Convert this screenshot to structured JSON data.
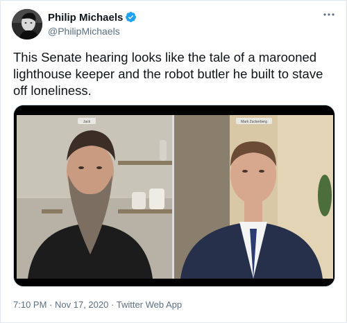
{
  "author": {
    "name": "Philip Michaels",
    "handle": "@PhilipMichaels",
    "verified": true
  },
  "menu_icon": "more-horizontal-icon",
  "tweet": {
    "text": "This Senate hearing looks like the tale of a marooned lighthouse keeper and the robot butler he built to stave off loneliness."
  },
  "media": {
    "left_nameplate": "Jack",
    "right_nameplate": "Mark Zuckerberg"
  },
  "meta": {
    "time": "7:10 PM",
    "separator": "·",
    "date": "Nov 17, 2020",
    "source": "Twitter Web App"
  },
  "colors": {
    "text": "#0f1419",
    "secondary": "#5b7083",
    "verified": "#1da1f2",
    "border": "#cfd9de"
  }
}
